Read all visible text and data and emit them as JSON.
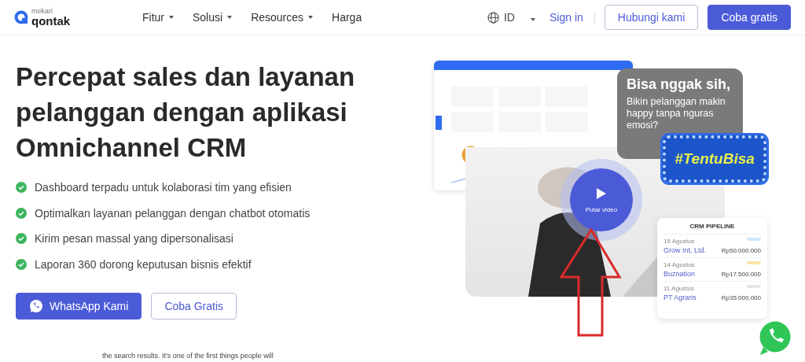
{
  "header": {
    "logo": {
      "small": "mekari",
      "name": "qontak"
    },
    "menu": [
      {
        "label": "Fitur",
        "has_caret": true
      },
      {
        "label": "Solusi",
        "has_caret": true
      },
      {
        "label": "Resources",
        "has_caret": true
      },
      {
        "label": "Harga",
        "has_caret": false
      }
    ],
    "language": "ID",
    "sign_in": "Sign in",
    "contact_button": "Hubungi kami",
    "trial_button": "Coba gratis"
  },
  "hero": {
    "title": "Percepat sales dan layanan pelanggan dengan aplikasi Omnichannel CRM",
    "features": [
      "Dashboard terpadu untuk kolaborasi tim yang efisien",
      "Optimalkan layanan pelanggan dengan chatbot otomatis",
      "Kirim pesan massal yang dipersonalisasi",
      "Laporan 360 dorong keputusan bisnis efektif"
    ],
    "whatsapp_button": "WhatsApp Kami",
    "trial_button": "Coba Gratis"
  },
  "visual": {
    "bubble": {
      "heading": "Bisa nggak sih,",
      "text": "Bikin pelanggan makin happy tanpa nguras emosi?"
    },
    "hashtag": "#TentuBisa",
    "play_label": "Putar video",
    "pipeline": {
      "title": "CRM PIPELINE",
      "deals": [
        {
          "date": "15 Agustus",
          "name": "Grow Int, Ltd.",
          "amount": "Rp50.000.000",
          "color": "#cfe6fb"
        },
        {
          "date": "14 Agustus",
          "name": "Buznation",
          "amount": "Rp17.500.000",
          "color": "#fbe6a8"
        },
        {
          "date": "11 Agustus",
          "name": "PT Agraris",
          "amount": "Rp35.000.000",
          "color": "#e3e8e6"
        }
      ]
    }
  },
  "footer_text": "the search results. It's one of the first things people will"
}
